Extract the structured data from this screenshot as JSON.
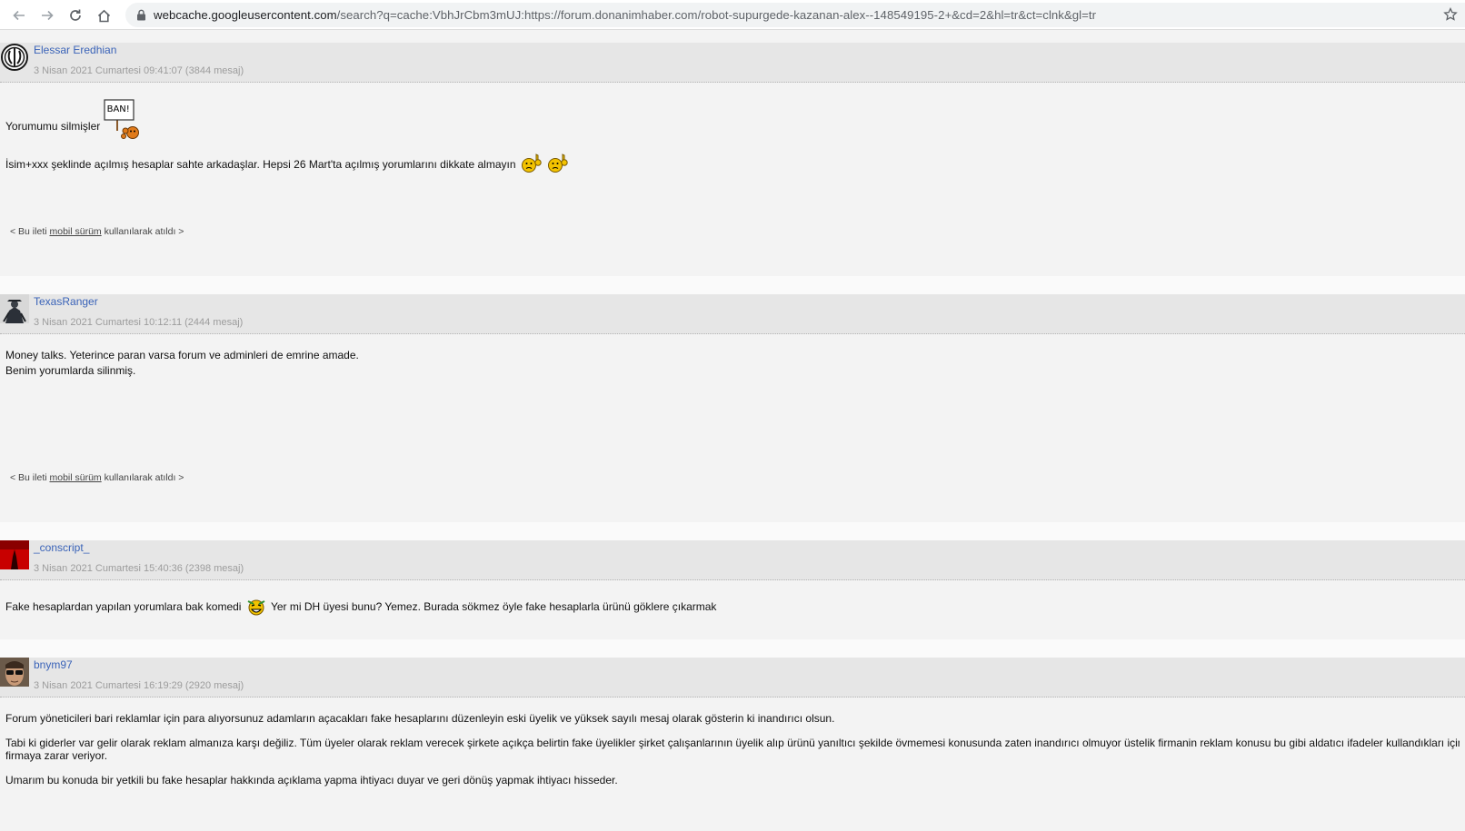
{
  "browser": {
    "url_host": "webcache.googleusercontent.com",
    "url_rest": "/search?q=cache:VbhJrCbm3mUJ:https://forum.donanimhaber.com/robot-supurgede-kazanan-alex--148549195-2+&cd=2&hl=tr&ct=clnk&gl=tr"
  },
  "mobile_note": {
    "prefix": "< Bu ileti ",
    "link": "mobil sürüm",
    "suffix": " kullanılarak atıldı >"
  },
  "posts": [
    {
      "username": "Elessar Eredhian",
      "meta": "3 Nisan 2021 Cumartesi 09:41:07 (3844 mesaj)",
      "line1": "Yorumumu silmişler",
      "ban_sign": "BAN!",
      "line2": "İsim+xxx şeklinde açılmış hesaplar sahte arkadaşlar. Hepsi 26 Mart'ta açılmış yorumlarını dikkate almayın"
    },
    {
      "username": "TexasRanger",
      "meta": "3 Nisan 2021 Cumartesi 10:12:11 (2444 mesaj)",
      "line1": "Money talks. Yeterince paran varsa forum ve adminleri de emrine amade.",
      "line2": "Benim yorumlarda silinmiş."
    },
    {
      "username": "_conscript_",
      "meta": "3 Nisan 2021 Cumartesi 15:40:36 (2398 mesaj)",
      "line1a": "Fake hesaplardan yapılan yorumlara bak komedi",
      "line1b": "Yer mi DH üyesi bunu? Yemez. Burada sökmez öyle fake hesaplarla ürünü göklere çıkarmak"
    },
    {
      "username": "bnym97",
      "meta": "3 Nisan 2021 Cumartesi 16:19:29 (2920 mesaj)",
      "p1": "Forum yöneticileri bari reklamlar için para alıyorsunuz adamların açacakları fake hesaplarını düzenleyin eski üyelik ve yüksek sayılı mesaj olarak gösterin ki inandırıcı olsun.",
      "p2a": "Tabi ki giderler var gelir olarak reklam almanıza karşı değiliz. Tüm üyeler olarak reklam verecek şirkete açıkça belirtin fake üyelikler şirket çalışanlarının üyelik alıp ürünü yanıltıcı şekilde övmemesi konusunda zaten inandırıcı olmuyor üstelik firmanin reklam konusu bu gibi aldatıcı ifadeler kullandıkları için",
      "p2b": "firmaya zarar veriyor.",
      "p3": "Umarım bu konuda bir yetkili bu fake hesaplar hakkında açıklama yapma ihtiyacı duyar ve geri dönüş yapmak ihtiyacı hisseder."
    }
  ]
}
